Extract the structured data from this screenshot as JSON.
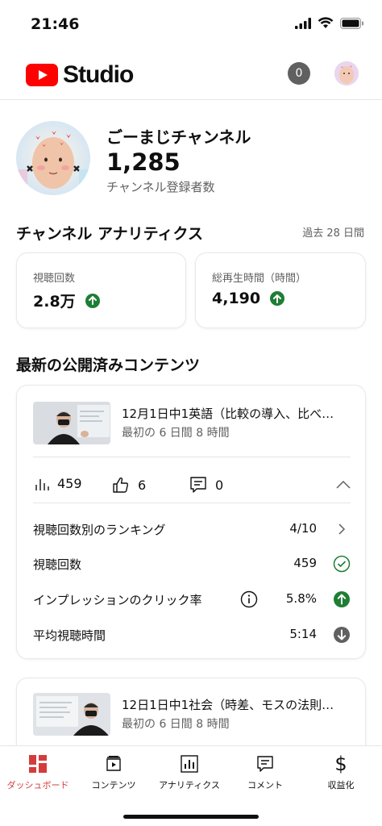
{
  "status_bar": {
    "time": "21:46"
  },
  "header": {
    "logo_text": "Studio",
    "notification_count": "0"
  },
  "channel": {
    "name": "ごーまじチャンネル",
    "subscriber_count": "1,285",
    "subscriber_label": "チャンネル登録者数"
  },
  "analytics": {
    "title": "チャンネル アナリティクス",
    "period": "過去 28 日間",
    "metrics": [
      {
        "label": "視聴回数",
        "value": "2.8万",
        "trend": "up"
      },
      {
        "label": "総再生時間（時間）",
        "value": "4,190",
        "trend": "up"
      }
    ]
  },
  "latest": {
    "title": "最新の公開済みコンテンツ",
    "videos": [
      {
        "title": "12月1日中1英語（比較の導入、比べ…",
        "subtitle": "最初の 6 日間 8 時間",
        "views": "459",
        "likes": "6",
        "comments": "0",
        "details": [
          {
            "label": "視聴回数別のランキング",
            "value": "4/10",
            "icon": "chevron-right"
          },
          {
            "label": "視聴回数",
            "value": "459",
            "icon": "check-circle"
          },
          {
            "label": "インプレッションのクリック率",
            "value": "5.8%",
            "icon": "up-arrow-circle"
          },
          {
            "label": "平均視聴時間",
            "value": "5:14",
            "icon": "down-arrow-circle"
          }
        ]
      },
      {
        "title": "12日1日中1社会（時差、モスの法則…",
        "subtitle": "最初の 6 日間 8 時間"
      }
    ]
  },
  "bottom_nav": {
    "items": [
      {
        "label": "ダッシュボード",
        "active": true
      },
      {
        "label": "コンテンツ"
      },
      {
        "label": "アナリティクス"
      },
      {
        "label": "コメント"
      },
      {
        "label": "収益化"
      }
    ]
  },
  "colors": {
    "accent_red": "#d43c3c",
    "trend_green": "#1e7e34",
    "youtube_red": "#ff0000"
  }
}
